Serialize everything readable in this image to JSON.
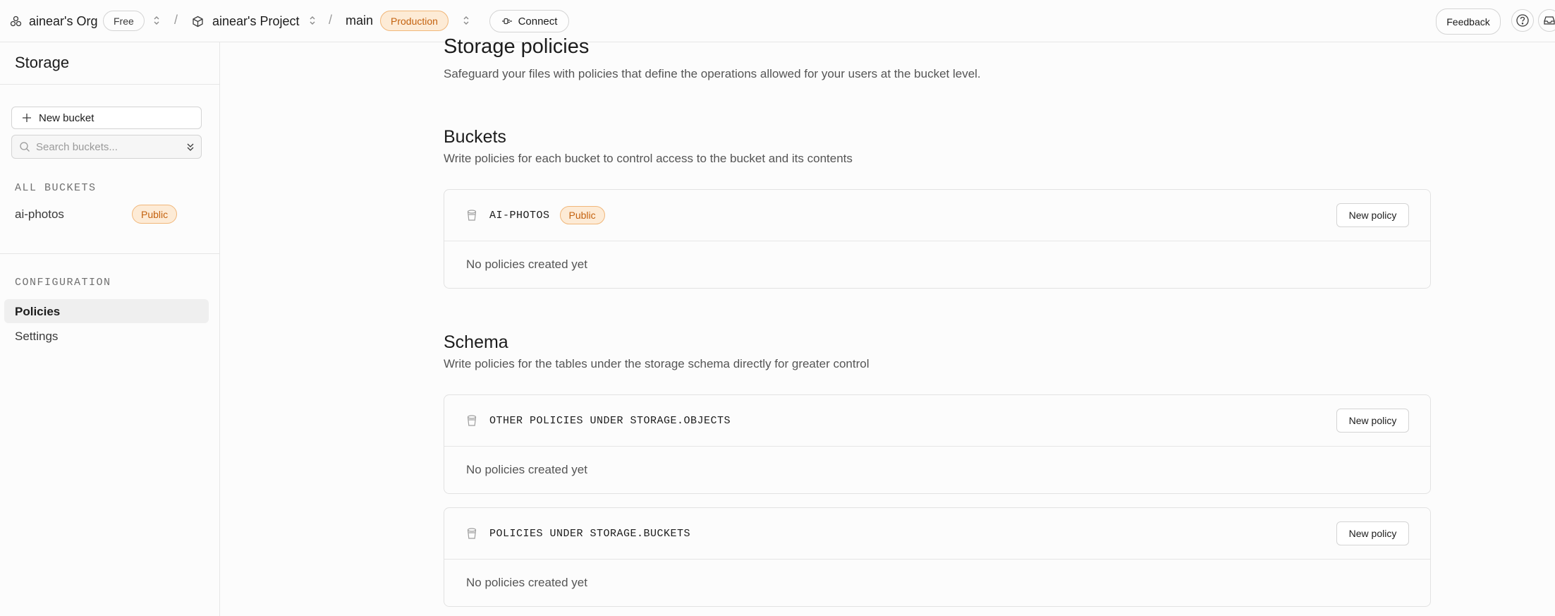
{
  "topbar": {
    "org_name": "ainear's Org",
    "org_plan": "Free",
    "separator": "/",
    "project_name": "ainear's Project",
    "branch_name": "main",
    "branch_env": "Production",
    "connect_label": "Connect",
    "feedback_label": "Feedback"
  },
  "sidebar": {
    "title": "Storage",
    "new_bucket_label": "New bucket",
    "search_placeholder": "Search buckets...",
    "all_buckets_heading": "ALL BUCKETS",
    "buckets": [
      {
        "name": "ai-photos",
        "badge": "Public"
      }
    ],
    "configuration_heading": "CONFIGURATION",
    "config_items": [
      {
        "label": "Policies",
        "active": true
      },
      {
        "label": "Settings",
        "active": false
      }
    ]
  },
  "main": {
    "title": "Storage policies",
    "subtitle": "Safeguard your files with policies that define the operations allowed for your users at the bucket level.",
    "buckets_section": {
      "title": "Buckets",
      "description": "Write policies for each bucket to control access to the bucket and its contents",
      "cards": [
        {
          "name": "AI-PHOTOS",
          "badge": "Public",
          "button": "New policy",
          "empty": "No policies created yet"
        }
      ]
    },
    "schema_section": {
      "title": "Schema",
      "description": "Write policies for the tables under the storage schema directly for greater control",
      "cards": [
        {
          "name": "OTHER POLICIES UNDER STORAGE.OBJECTS",
          "button": "New policy",
          "empty": "No policies created yet"
        },
        {
          "name": "POLICIES UNDER STORAGE.BUCKETS",
          "button": "New policy",
          "empty": "No policies created yet"
        }
      ]
    }
  },
  "colors": {
    "accent_warning_bg": "#fdebd6",
    "accent_warning_text": "#c4620f",
    "border": "#e2e2e2"
  },
  "icons": [
    "org-icon",
    "chevron-updown-icon",
    "project-box-icon",
    "connect-plug-icon",
    "help-icon",
    "inbox-icon",
    "plus-icon",
    "search-icon",
    "sort-icon",
    "bucket-icon"
  ]
}
